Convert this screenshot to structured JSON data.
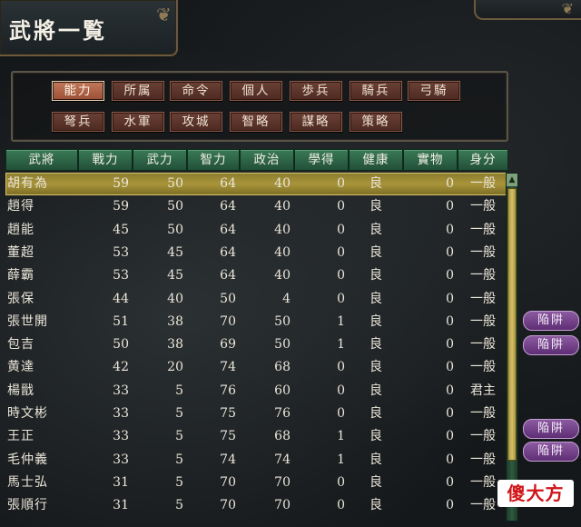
{
  "window": {
    "title": "武將一覧"
  },
  "tabs": [
    {
      "label": "能力",
      "active": true
    },
    {
      "label": "所属",
      "active": false
    },
    {
      "label": "命令",
      "active": false
    },
    {
      "label": "個人",
      "active": false
    },
    {
      "label": "歩兵",
      "active": false
    },
    {
      "label": "騎兵",
      "active": false
    },
    {
      "label": "弓騎",
      "active": false
    },
    {
      "label": "弩兵",
      "active": false
    },
    {
      "label": "水軍",
      "active": false
    },
    {
      "label": "攻城",
      "active": false
    },
    {
      "label": "智略",
      "active": false
    },
    {
      "label": "謀略",
      "active": false
    },
    {
      "label": "策略",
      "active": false
    }
  ],
  "table": {
    "columns": [
      "武將",
      "戰力",
      "武力",
      "智力",
      "政治",
      "學得",
      "健康",
      "實物",
      "身分"
    ],
    "rows": [
      [
        "胡有為",
        "59",
        "50",
        "64",
        "40",
        "0",
        "良",
        "0",
        "一般"
      ],
      [
        "趙得",
        "59",
        "50",
        "64",
        "40",
        "0",
        "良",
        "0",
        "一般"
      ],
      [
        "趙能",
        "45",
        "50",
        "64",
        "40",
        "0",
        "良",
        "0",
        "一般"
      ],
      [
        "董超",
        "53",
        "45",
        "64",
        "40",
        "0",
        "良",
        "0",
        "一般"
      ],
      [
        "薛霸",
        "53",
        "45",
        "64",
        "40",
        "0",
        "良",
        "0",
        "一般"
      ],
      [
        "張保",
        "44",
        "40",
        "50",
        "4",
        "0",
        "良",
        "0",
        "一般"
      ],
      [
        "張世開",
        "51",
        "38",
        "70",
        "50",
        "1",
        "良",
        "0",
        "一般"
      ],
      [
        "包吉",
        "50",
        "38",
        "69",
        "50",
        "1",
        "良",
        "0",
        "一般"
      ],
      [
        "黄達",
        "42",
        "20",
        "74",
        "68",
        "0",
        "良",
        "0",
        "一般"
      ],
      [
        "楊戩",
        "33",
        "5",
        "76",
        "60",
        "0",
        "良",
        "0",
        "君主"
      ],
      [
        "時文彬",
        "33",
        "5",
        "75",
        "76",
        "0",
        "良",
        "0",
        "一般"
      ],
      [
        "王正",
        "33",
        "5",
        "75",
        "68",
        "1",
        "良",
        "0",
        "一般"
      ],
      [
        "毛仲義",
        "33",
        "5",
        "74",
        "74",
        "1",
        "良",
        "0",
        "一般"
      ],
      [
        "馬士弘",
        "31",
        "5",
        "70",
        "70",
        "0",
        "良",
        "0",
        "一般"
      ],
      [
        "張順行",
        "31",
        "5",
        "70",
        "70",
        "0",
        "良",
        "0",
        "一般"
      ]
    ],
    "selected_row_index": 0
  },
  "trap_buttons": [
    "陥阱",
    "陥阱",
    "陥阱",
    "陥阱"
  ],
  "watermark": {
    "text": "傻大方"
  },
  "colors": {
    "tab_active": "#c27a5a",
    "tab_inactive": "#4d2a22",
    "header": "#2e6a48",
    "selected_row": "#a8943a",
    "trap_button": "#6e3a86",
    "watermark": "#d0161a"
  }
}
